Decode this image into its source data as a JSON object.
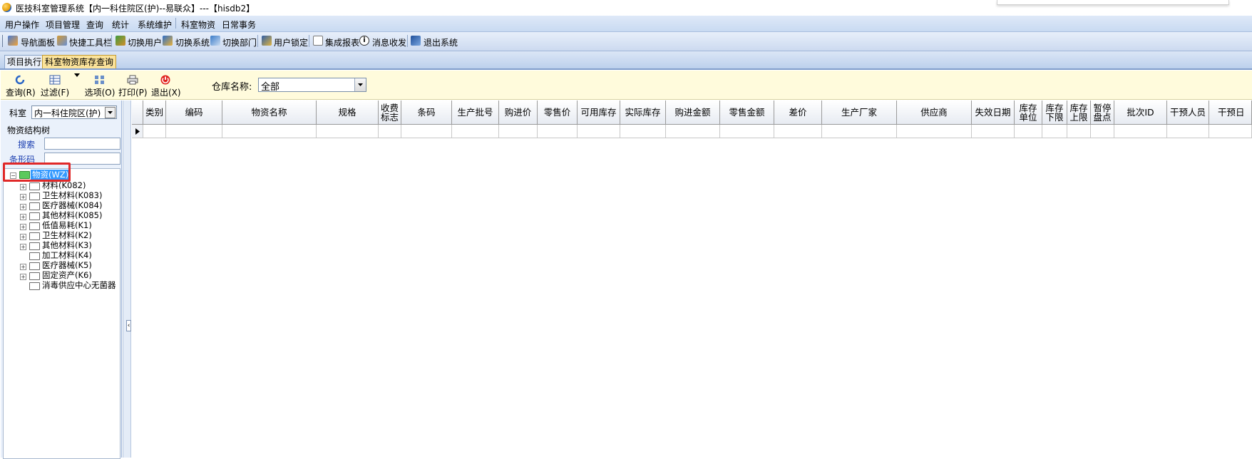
{
  "window": {
    "title": "医技科室管理系统【内一科住院区(护)--易联众】---【hisdb2】"
  },
  "menubar": {
    "items": [
      "用户操作",
      "项目管理",
      "查询",
      "统计",
      "系统维护",
      "科室物资",
      "日常事务"
    ]
  },
  "toolbar": {
    "items": [
      "导航面板",
      "快捷工具栏",
      "切换用户",
      "切换系统",
      "切换部门",
      "用户锁定",
      "集成报表",
      "消息收发",
      "退出系统"
    ]
  },
  "tabs": [
    {
      "label": "项目执行",
      "active": false
    },
    {
      "label": "科室物资库存查询",
      "active": true
    }
  ],
  "actions": {
    "query": "查询(R)",
    "filter": "过滤(F)",
    "options": "选项(O)",
    "print": "打印(P)",
    "exit": "退出(X)"
  },
  "warehouse": {
    "label": "仓库名称:",
    "value": "全部"
  },
  "left": {
    "dept_label": "科室",
    "dept_value": "内一科住院区(护)",
    "tree_group_label": "物资结构树",
    "search_label": "搜索",
    "barcode_label": "条形码",
    "tree_root": "物资(WZ)",
    "tree_items": [
      "材料(K082)",
      "卫生材料(K083)",
      "医疗器械(K084)",
      "其他材料(K085)",
      "低值易耗(K1)",
      "卫生材料(K2)",
      "其他材料(K3)",
      "加工材料(K4)",
      "医疗器械(K5)",
      "固定资产(K6)",
      "消毒供应中心无菌器"
    ]
  },
  "grid": {
    "columns": [
      "类别",
      "编码",
      "物资名称",
      "规格",
      "收费标志",
      "条码",
      "生产批号",
      "购进价",
      "零售价",
      "可用库存",
      "实际库存",
      "购进金额",
      "零售金额",
      "差价",
      "生产厂家",
      "供应商",
      "失效日期",
      "库存单位",
      "库存下限",
      "库存上限",
      "暂停盘点",
      "批次ID",
      "干预人员",
      "干预日"
    ]
  },
  "colors": {
    "accent": "#fbe39a",
    "highlight_box": "#e02828",
    "selected_node": "#3399ff"
  }
}
